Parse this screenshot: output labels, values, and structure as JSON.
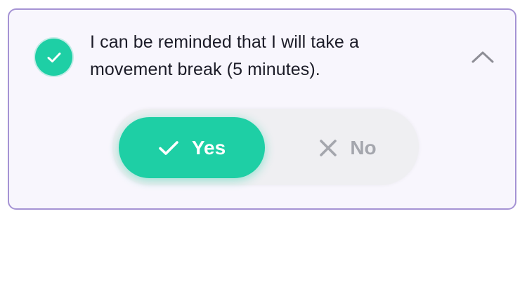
{
  "card": {
    "question": "I can be reminded that I will take a movement break (5 minutes).",
    "status_icon": "check-circle-icon",
    "collapse_icon": "chevron-up-icon"
  },
  "toggle": {
    "selected": "yes",
    "yes_label": "Yes",
    "no_label": "No",
    "yes_icon": "check-icon",
    "no_icon": "x-icon"
  },
  "colors": {
    "accent": "#1ecfa5",
    "card_border": "#a593d4",
    "card_background": "#f8f6fd",
    "toggle_track": "#efeff2",
    "muted": "#a4a6ad",
    "text": "#1c1c28"
  }
}
